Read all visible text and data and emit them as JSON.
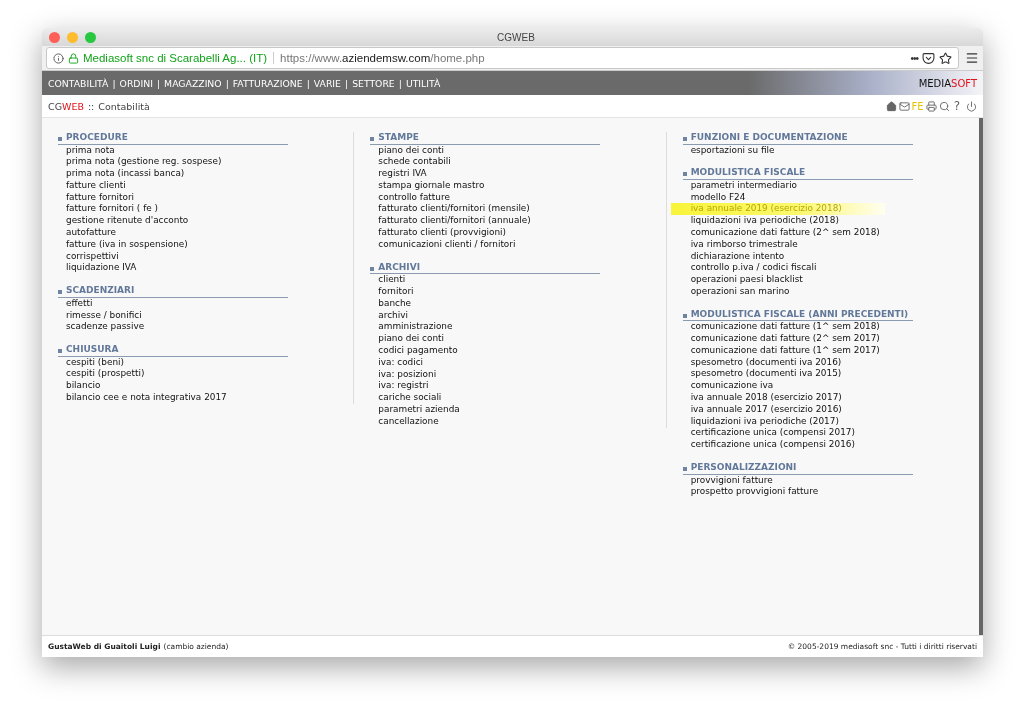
{
  "window": {
    "title": "CGWEB"
  },
  "address_bar": {
    "site_identity": "Mediasoft snc di Scarabelli Ag... (IT)",
    "url_prefix": "https://www.",
    "url_domain": "aziendemsw.com",
    "url_path": "/home.php",
    "more": "•••"
  },
  "menu": {
    "separator": "|",
    "items": [
      "CONTABILITÀ",
      "ORDINI",
      "MAGAZZINO",
      "FATTURAZIONE",
      "VARIE",
      "SETTORE",
      "UTILITÀ"
    ],
    "logo_a": "MEDIA",
    "logo_b": "SOFT"
  },
  "breadcrumb": {
    "brand_a": "CG",
    "brand_b": "WEB",
    "separator": "::",
    "page": "Contabilità"
  },
  "toolbar": {
    "fe": "FE",
    "help": "?"
  },
  "columns": [
    [
      {
        "title": "PROCEDURE",
        "items": [
          {
            "label": "prima nota",
            "highlighted": false
          },
          {
            "label": "prima nota (gestione reg. sospese)",
            "highlighted": false
          },
          {
            "label": "prima nota (incassi banca)",
            "highlighted": false
          },
          {
            "label": "fatture clienti",
            "highlighted": false
          },
          {
            "label": "fatture fornitori",
            "highlighted": false
          },
          {
            "label": "fatture fornitori ( fe )",
            "highlighted": false
          },
          {
            "label": "gestione ritenute d'acconto",
            "highlighted": false
          },
          {
            "label": "autofatture",
            "highlighted": false
          },
          {
            "label": "fatture (iva in sospensione)",
            "highlighted": false
          },
          {
            "label": "corrispettivi",
            "highlighted": false
          },
          {
            "label": "liquidazione IVA",
            "highlighted": false
          }
        ]
      },
      {
        "title": "SCADENZIARI",
        "items": [
          {
            "label": "effetti",
            "highlighted": false
          },
          {
            "label": "rimesse / bonifici",
            "highlighted": false
          },
          {
            "label": "scadenze passive",
            "highlighted": false
          }
        ]
      },
      {
        "title": "CHIUSURA",
        "items": [
          {
            "label": "cespiti (beni)",
            "highlighted": false
          },
          {
            "label": "cespiti (prospetti)",
            "highlighted": false
          },
          {
            "label": "bilancio",
            "highlighted": false
          },
          {
            "label": "bilancio cee e nota integrativa 2017",
            "highlighted": false
          }
        ]
      }
    ],
    [
      {
        "title": "STAMPE",
        "items": [
          {
            "label": "piano dei conti",
            "highlighted": false
          },
          {
            "label": "schede contabili",
            "highlighted": false
          },
          {
            "label": "registri IVA",
            "highlighted": false
          },
          {
            "label": "stampa giornale mastro",
            "highlighted": false
          },
          {
            "label": "controllo fatture",
            "highlighted": false
          },
          {
            "label": "fatturato clienti/fornitori (mensile)",
            "highlighted": false
          },
          {
            "label": "fatturato clienti/fornitori (annuale)",
            "highlighted": false
          },
          {
            "label": "fatturato clienti (provvigioni)",
            "highlighted": false
          },
          {
            "label": "comunicazioni clienti / fornitori",
            "highlighted": false
          }
        ]
      },
      {
        "title": "ARCHIVI",
        "items": [
          {
            "label": "clienti",
            "highlighted": false
          },
          {
            "label": "fornitori",
            "highlighted": false
          },
          {
            "label": "banche",
            "highlighted": false
          },
          {
            "label": "archivi",
            "highlighted": false
          },
          {
            "label": "amministrazione",
            "highlighted": false
          },
          {
            "label": "piano dei conti",
            "highlighted": false
          },
          {
            "label": "codici pagamento",
            "highlighted": false
          },
          {
            "label": "iva: codici",
            "highlighted": false
          },
          {
            "label": "iva: posizioni",
            "highlighted": false
          },
          {
            "label": "iva: registri",
            "highlighted": false
          },
          {
            "label": "cariche sociali",
            "highlighted": false
          },
          {
            "label": "parametri azienda",
            "highlighted": false
          },
          {
            "label": "cancellazione",
            "highlighted": false
          }
        ]
      }
    ],
    [
      {
        "title": "FUNZIONI E DOCUMENTAZIONE",
        "items": [
          {
            "label": "esportazioni su file",
            "highlighted": false
          }
        ]
      },
      {
        "title": "MODULISTICA FISCALE",
        "items": [
          {
            "label": "parametri intermediario",
            "highlighted": false
          },
          {
            "label": "modello F24",
            "highlighted": false
          },
          {
            "label": "iva annuale 2019 (esercizio 2018)",
            "highlighted": true
          },
          {
            "label": "liquidazioni iva periodiche (2018)",
            "highlighted": false
          },
          {
            "label": "comunicazione dati fatture (2^ sem 2018)",
            "highlighted": false
          },
          {
            "label": "iva rimborso trimestrale",
            "highlighted": false
          },
          {
            "label": "dichiarazione intento",
            "highlighted": false
          },
          {
            "label": "controllo p.iva / codici fiscali",
            "highlighted": false
          },
          {
            "label": "operazioni paesi blacklist",
            "highlighted": false
          },
          {
            "label": "operazioni san marino",
            "highlighted": false
          }
        ]
      },
      {
        "title": "MODULISTICA FISCALE (ANNI PRECEDENTI)",
        "items": [
          {
            "label": "comunicazione dati fatture (1^ sem 2018)",
            "highlighted": false
          },
          {
            "label": "comunicazione dati fatture (2^ sem 2017)",
            "highlighted": false
          },
          {
            "label": "comunicazione dati fatture (1^ sem 2017)",
            "highlighted": false
          },
          {
            "label": "spesometro (documenti iva 2016)",
            "highlighted": false
          },
          {
            "label": "spesometro (documenti iva 2015)",
            "highlighted": false
          },
          {
            "label": "comunicazione iva",
            "highlighted": false
          },
          {
            "label": "iva annuale 2018 (esercizio 2017)",
            "highlighted": false
          },
          {
            "label": "iva annuale 2017 (esercizio 2016)",
            "highlighted": false
          },
          {
            "label": "liquidazioni iva periodiche (2017)",
            "highlighted": false
          },
          {
            "label": "certificazione unica (compensi 2017)",
            "highlighted": false
          },
          {
            "label": "certificazione unica (compensi 2016)",
            "highlighted": false
          }
        ]
      },
      {
        "title": "PERSONALIZZAZIONI",
        "items": [
          {
            "label": "provvigioni fatture",
            "highlighted": false
          },
          {
            "label": "prospetto provvigioni fatture",
            "highlighted": false
          }
        ]
      }
    ]
  ],
  "footer": {
    "company": "GustaWeb di Guaitoli Luigi",
    "change_link": "(cambio azienda)",
    "copyright": "© 2005-2019 mediasoft snc - Tutti i diritti riservati"
  }
}
